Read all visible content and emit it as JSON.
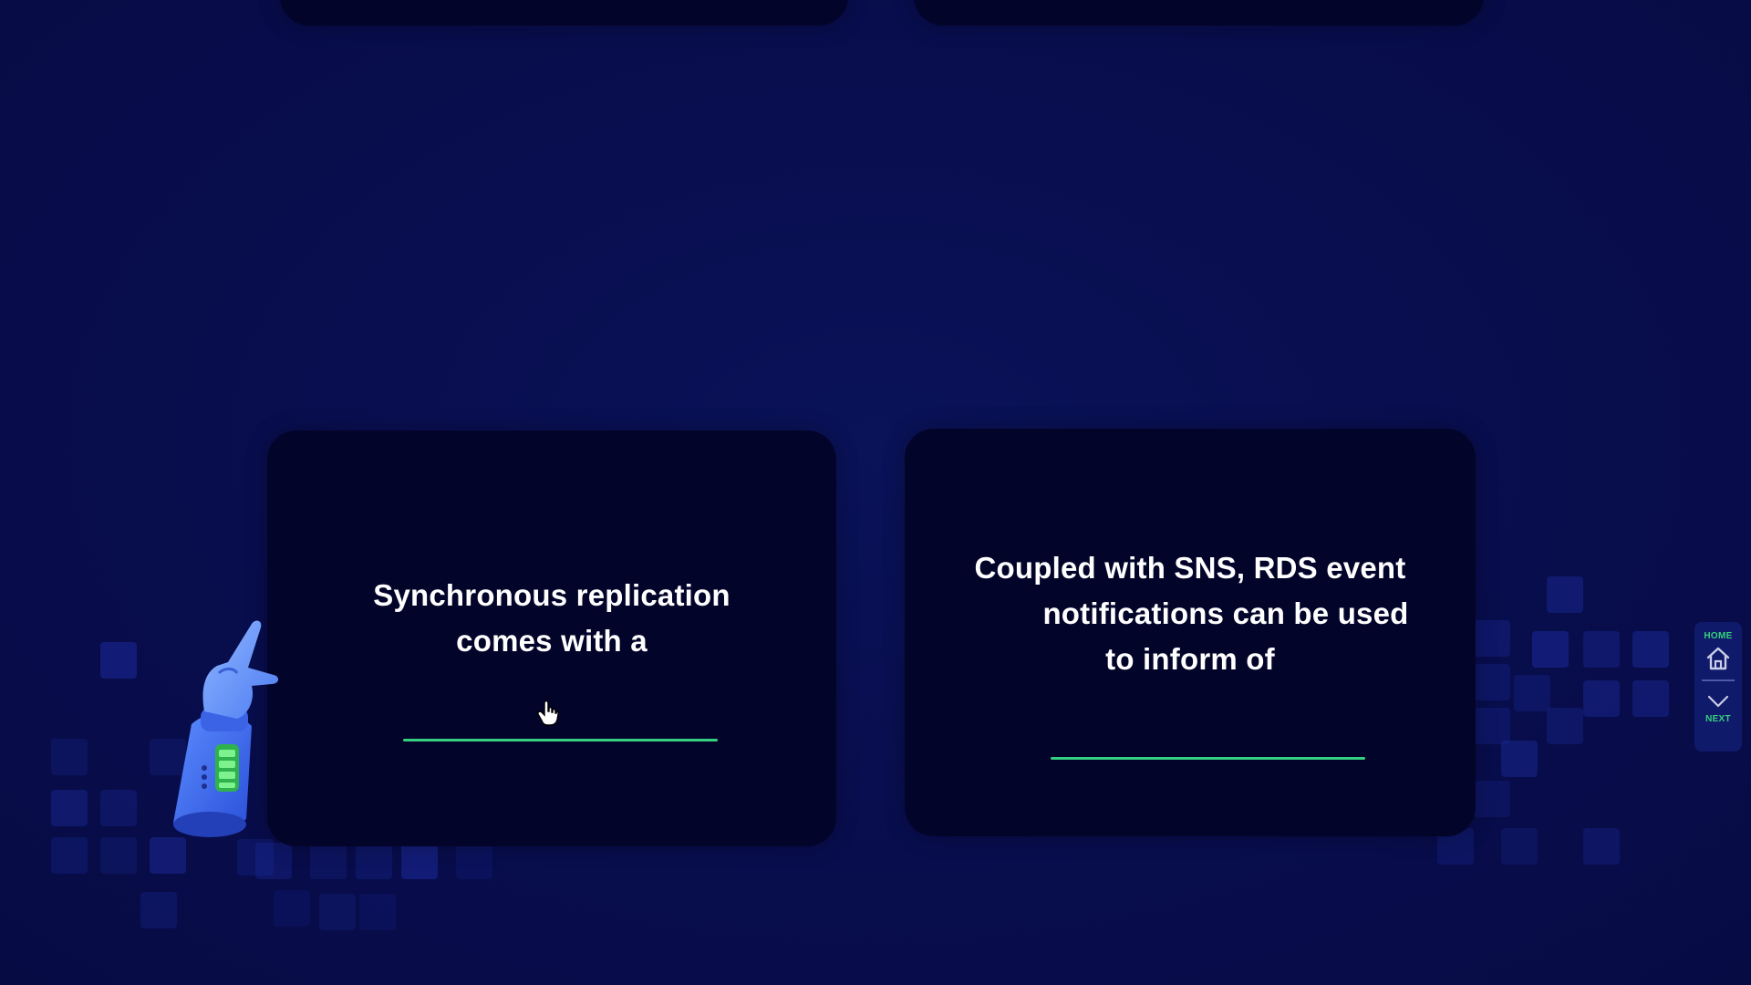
{
  "cards": [
    {
      "lines": [
        "Synchronous replication",
        "comes with a"
      ]
    },
    {
      "lines": [
        "Coupled with SNS, RDS event",
        "notifications can be used",
        "to inform of"
      ]
    }
  ],
  "nav": {
    "home_label": "HOME",
    "next_label": "NEXT"
  },
  "colors": {
    "background": "#080d4a",
    "card": "#03042a",
    "accent_green": "#35d07f",
    "text": "#ffffff"
  },
  "icons": [
    "home-icon",
    "chevron-down-icon",
    "hand-cursor-icon",
    "robot-hand-illustration"
  ]
}
